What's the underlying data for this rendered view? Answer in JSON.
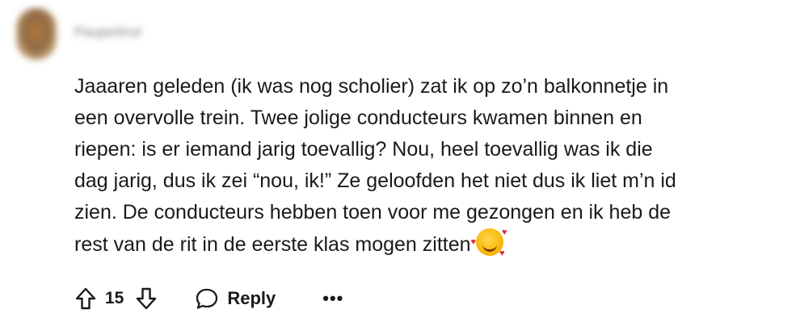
{
  "comment": {
    "username": "Pauperkrul",
    "body_lines": [
      "Jaaaren geleden (ik was nog scholier) zat ik op zo’n balkonnetje in",
      "een overvolle trein. Twee jolige conducteurs kwamen binnen en",
      "riepen: is er iemand jarig toevallig? Nou, heel toevallig was ik die",
      "dag jarig, dus ik zei “nou, ik!” Ze geloofden het niet dus ik liet m’n id",
      "zien. De conducteurs hebben toen voor me gezongen en ik heb de",
      "rest van de rit in de eerste klas mogen zitten"
    ],
    "emoji": "smiling-face-with-hearts"
  },
  "actions": {
    "vote_count": "15",
    "reply_label": "Reply",
    "more_label": "•••"
  },
  "icons": {
    "upvote": "arrow-up-icon",
    "downvote": "arrow-down-icon",
    "reply": "speech-bubble-icon",
    "more": "more-dots-icon"
  }
}
